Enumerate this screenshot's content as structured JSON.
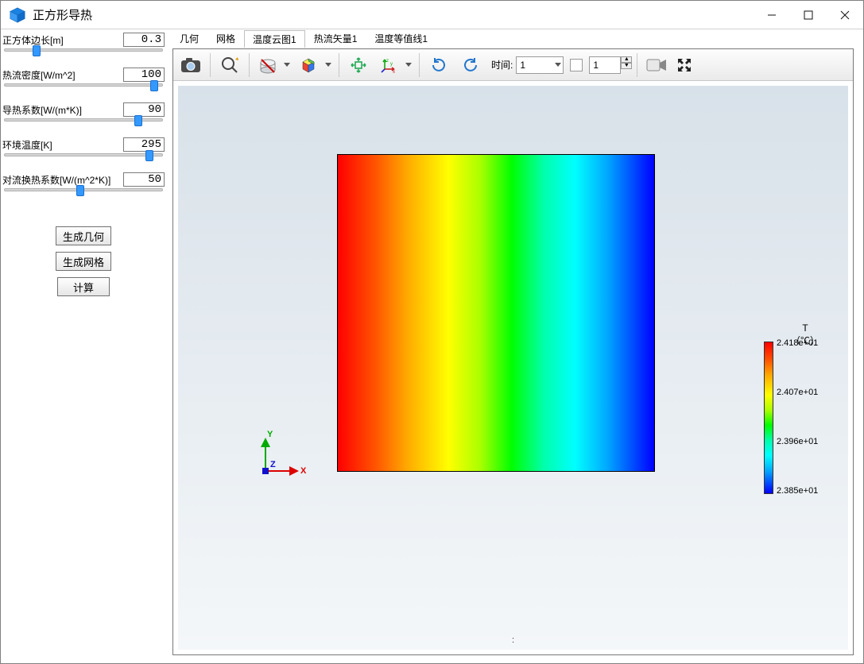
{
  "window": {
    "title": "正方形导热"
  },
  "sidebar": {
    "params": [
      {
        "label": "正方体边长[m]",
        "value": "0.3",
        "thumb_percent": 20
      },
      {
        "label": "热流密度[W/m^2]",
        "value": "100",
        "thumb_percent": 95
      },
      {
        "label": "导热系数[W/(m*K)]",
        "value": "90",
        "thumb_percent": 85
      },
      {
        "label": "环境温度[K]",
        "value": "295",
        "thumb_percent": 92
      },
      {
        "label": "对流换热系数[W/(m^2*K)]",
        "value": "50",
        "thumb_percent": 48
      }
    ],
    "buttons": [
      "生成几何",
      "生成网格",
      "计算"
    ]
  },
  "tabs": {
    "items": [
      "几何",
      "网格",
      "温度云图1",
      "热流矢量1",
      "温度等值线1"
    ],
    "active_index": 2
  },
  "toolbar": {
    "time_label": "时间:",
    "time_value": "1",
    "spin_value": "1"
  },
  "colorbar": {
    "title_line1": "T",
    "title_line2": "（℃）",
    "labels": [
      "2.418e+01",
      "2.407e+01",
      "2.396e+01",
      "2.385e+01"
    ]
  },
  "axes": {
    "x": "X",
    "y": "Y",
    "z": "Z"
  },
  "status": ":",
  "chart_data": {
    "type": "heatmap",
    "title": "T (℃)",
    "xlabel": "X",
    "ylabel": "Y",
    "field": "Temperature",
    "unit": "℃",
    "color_range_min": 23.85,
    "color_range_max": 24.18,
    "colormap": "rainbow (red=high, blue=low)",
    "gradient_direction": "left-to-right (high to low)",
    "geometry": "square plate",
    "approx_values_along_x": [
      {
        "x_fraction": 0.0,
        "T": 24.18
      },
      {
        "x_fraction": 0.25,
        "T": 24.1
      },
      {
        "x_fraction": 0.5,
        "T": 24.02
      },
      {
        "x_fraction": 0.75,
        "T": 23.93
      },
      {
        "x_fraction": 1.0,
        "T": 23.85
      }
    ]
  }
}
